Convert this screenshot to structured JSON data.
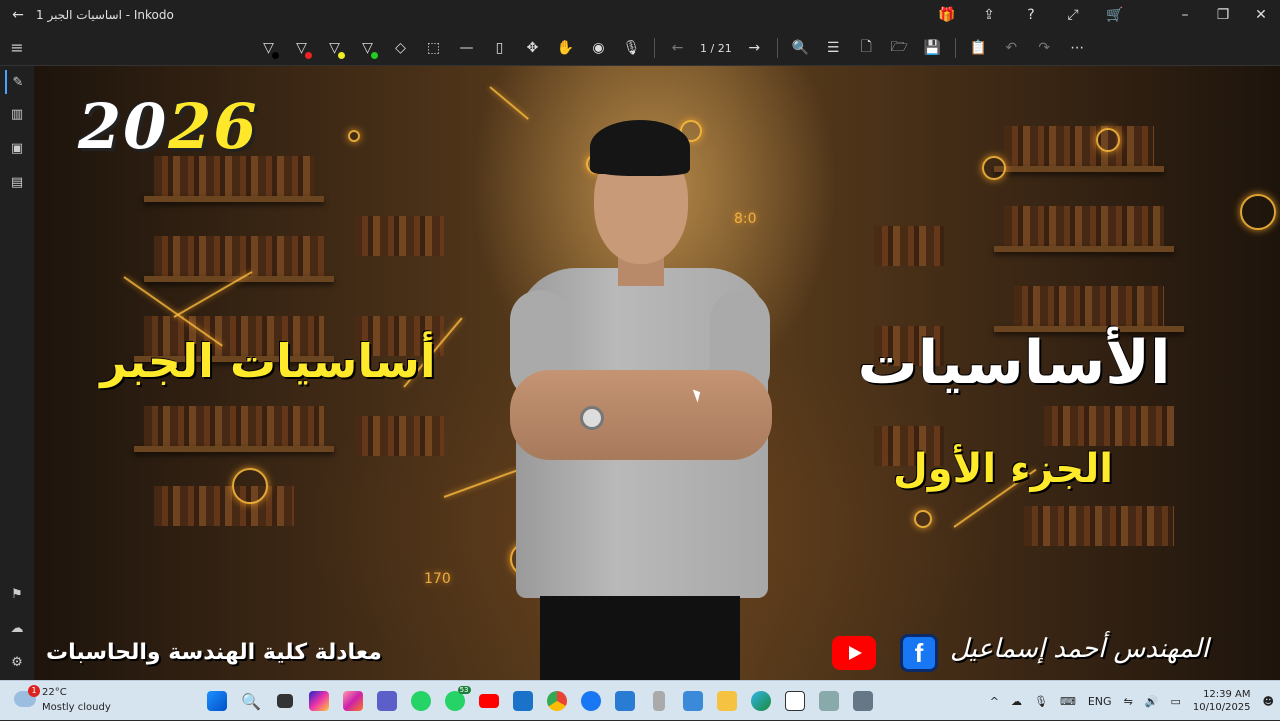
{
  "window": {
    "title": "اساسيات الجبر 1 - Inkodo"
  },
  "toolbar": {
    "page_indicator": "1 / 21"
  },
  "slide": {
    "year_prefix": "20",
    "year_suffix": "26",
    "left_title": "أساسيات الجبر",
    "right_title": "الأساسيات",
    "part_label": "الجزء الأول",
    "footer_left": "معادلة كلية الهندسة والحاسبات",
    "author": "المهندس أحمد إسماعيل",
    "numbers": [
      "8:0",
      "170"
    ],
    "facebook_letter": "f"
  },
  "taskbar": {
    "weather_temp": "22°C",
    "weather_desc": "Mostly cloudy",
    "weather_badge": "1",
    "whatsapp_count": "53",
    "language": "ENG",
    "time": "12:39 AM",
    "date": "10/10/2025"
  },
  "colors": {
    "accent_yellow": "#ffe92b",
    "youtube_red": "#ff0000",
    "facebook_blue": "#1877f2"
  }
}
